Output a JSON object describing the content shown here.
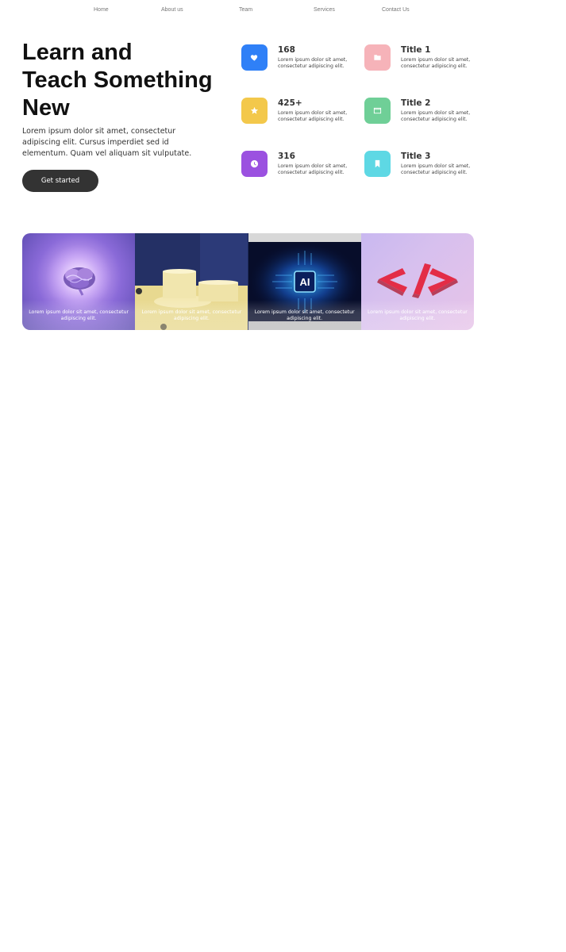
{
  "nav": {
    "items": [
      "Home",
      "About us",
      "Team",
      "Services",
      "Contact Us"
    ]
  },
  "hero": {
    "title_lines": [
      "Learn and",
      "Teach Something",
      "New"
    ],
    "description": "Lorem ipsum dolor sit amet, consectetur adipiscing elit. Cursus imperdiet sed id elementum. Quam vel aliquam sit vulputate.",
    "cta_label": "Get started"
  },
  "features": [
    {
      "title": "168",
      "text": "Lorem ipsum dolor sit amet, consectetur adipiscing elit.",
      "icon": "heart-icon",
      "color": "#2f80f7"
    },
    {
      "title": "Title 1",
      "text": "Lorem ipsum dolor sit amet, consectetur adipiscing elit.",
      "icon": "folder-icon",
      "color": "#f6b3b9"
    },
    {
      "title": "425+",
      "text": "Lorem ipsum dolor sit amet, consectetur adipiscing elit.",
      "icon": "star-icon",
      "color": "#f3c84b"
    },
    {
      "title": "Title 2",
      "text": "Lorem ipsum dolor sit amet, consectetur adipiscing elit.",
      "icon": "browser-icon",
      "color": "#6fcf97"
    },
    {
      "title": "316",
      "text": "Lorem ipsum dolor sit amet, consectetur adipiscing elit.",
      "icon": "clock-icon",
      "color": "#9b51e0"
    },
    {
      "title": "Title 3",
      "text": "Lorem ipsum dolor sit amet, consectetur adipiscing elit.",
      "icon": "bookmark-icon",
      "color": "#5ed8e4"
    }
  ],
  "gallery": {
    "ai_label": "AI",
    "cards": [
      {
        "caption": "Lorem ipsum dolor sit amet, consectetur adipiscing elit.",
        "image": "glowing-brain"
      },
      {
        "caption": "Lorem ipsum dolor sit amet, consectetur adipiscing elit.",
        "image": "yellow-podiums"
      },
      {
        "caption": "Lorem ipsum dolor sit amet, consectetur adipiscing elit.",
        "image": "ai-chip"
      },
      {
        "caption": "Lorem ipsum dolor sit amet, consectetur adipiscing elit.",
        "image": "code-brackets"
      }
    ]
  }
}
